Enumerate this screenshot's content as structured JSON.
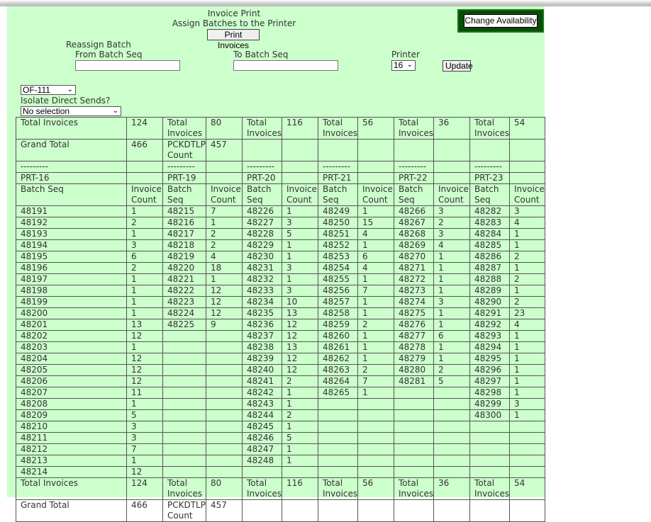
{
  "header": {
    "title": "Invoice Print",
    "subtitle": "Assign Batches to the Printer",
    "print_button": "Print Invoices",
    "change_availability_button": "Change Availability"
  },
  "reassign": {
    "title": "Reassign Batch",
    "from_label": "From Batch Seq",
    "from_value": "",
    "to_label": "To Batch Seq",
    "to_value": "",
    "printer_label": "Printer",
    "printer_value": "16",
    "update_button": "Update"
  },
  "filters": {
    "office_value": "OF-111",
    "isolate_label": "Isolate Direct Sends?",
    "isolate_value": "No selection"
  },
  "table": {
    "total_label": "Total Invoices",
    "grand_label": "Grand Total",
    "grand_value": "466",
    "total_value": "124",
    "pckdtlp_label": "PCKDTLP Count",
    "pckdtlp_value": "457",
    "separator": "---------",
    "batch_seq_label": "Batch Seq",
    "invoice_count_label": "Invoice Count",
    "printers": [
      {
        "name": "PRT-16",
        "total": "124"
      },
      {
        "name": "PRT-19",
        "total": "80"
      },
      {
        "name": "PRT-20",
        "total": "116"
      },
      {
        "name": "PRT-21",
        "total": "56"
      },
      {
        "name": "PRT-22",
        "total": "36"
      },
      {
        "name": "PRT-23",
        "total": "54"
      }
    ],
    "rows": [
      [
        "48191",
        "1",
        "48215",
        "7",
        "48226",
        "1",
        "48249",
        "1",
        "48266",
        "3",
        "48282",
        "3"
      ],
      [
        "48192",
        "2",
        "48216",
        "1",
        "48227",
        "3",
        "48250",
        "15",
        "48267",
        "2",
        "48283",
        "4"
      ],
      [
        "48193",
        "1",
        "48217",
        "2",
        "48228",
        "5",
        "48251",
        "4",
        "48268",
        "3",
        "48284",
        "1"
      ],
      [
        "48194",
        "3",
        "48218",
        "2",
        "48229",
        "1",
        "48252",
        "1",
        "48269",
        "4",
        "48285",
        "1"
      ],
      [
        "48195",
        "6",
        "48219",
        "4",
        "48230",
        "1",
        "48253",
        "6",
        "48270",
        "1",
        "48286",
        "2"
      ],
      [
        "48196",
        "2",
        "48220",
        "18",
        "48231",
        "3",
        "48254",
        "4",
        "48271",
        "1",
        "48287",
        "1"
      ],
      [
        "48197",
        "1",
        "48221",
        "1",
        "48232",
        "1",
        "48255",
        "1",
        "48272",
        "1",
        "48288",
        "2"
      ],
      [
        "48198",
        "1",
        "48222",
        "12",
        "48233",
        "3",
        "48256",
        "7",
        "48273",
        "1",
        "48289",
        "1"
      ],
      [
        "48199",
        "1",
        "48223",
        "12",
        "48234",
        "10",
        "48257",
        "1",
        "48274",
        "3",
        "48290",
        "2"
      ],
      [
        "48200",
        "1",
        "48224",
        "12",
        "48235",
        "13",
        "48258",
        "1",
        "48275",
        "1",
        "48291",
        "23"
      ],
      [
        "48201",
        "13",
        "48225",
        "9",
        "48236",
        "12",
        "48259",
        "2",
        "48276",
        "1",
        "48292",
        "4"
      ],
      [
        "48202",
        "12",
        "",
        "",
        "48237",
        "12",
        "48260",
        "1",
        "48277",
        "6",
        "48293",
        "1"
      ],
      [
        "48203",
        "1",
        "",
        "",
        "48238",
        "13",
        "48261",
        "1",
        "48278",
        "1",
        "48294",
        "1"
      ],
      [
        "48204",
        "12",
        "",
        "",
        "48239",
        "12",
        "48262",
        "1",
        "48279",
        "1",
        "48295",
        "1"
      ],
      [
        "48205",
        "12",
        "",
        "",
        "48240",
        "12",
        "48263",
        "2",
        "48280",
        "2",
        "48296",
        "1"
      ],
      [
        "48206",
        "12",
        "",
        "",
        "48241",
        "2",
        "48264",
        "7",
        "48281",
        "5",
        "48297",
        "1"
      ],
      [
        "48207",
        "11",
        "",
        "",
        "48242",
        "1",
        "48265",
        "1",
        "",
        "",
        "48298",
        "1"
      ],
      [
        "48208",
        "1",
        "",
        "",
        "48243",
        "1",
        "",
        "",
        "",
        "",
        "48299",
        "3"
      ],
      [
        "48209",
        "5",
        "",
        "",
        "48244",
        "2",
        "",
        "",
        "",
        "",
        "48300",
        "1"
      ],
      [
        "48210",
        "3",
        "",
        "",
        "48245",
        "1",
        "",
        "",
        "",
        "",
        "",
        ""
      ],
      [
        "48211",
        "3",
        "",
        "",
        "48246",
        "5",
        "",
        "",
        "",
        "",
        "",
        ""
      ],
      [
        "48212",
        "7",
        "",
        "",
        "48247",
        "1",
        "",
        "",
        "",
        "",
        "",
        ""
      ],
      [
        "48213",
        "1",
        "",
        "",
        "48248",
        "1",
        "",
        "",
        "",
        "",
        "",
        ""
      ],
      [
        "48214",
        "12",
        "",
        "",
        "",
        "",
        "",
        "",
        "",
        "",
        "",
        ""
      ]
    ]
  }
}
